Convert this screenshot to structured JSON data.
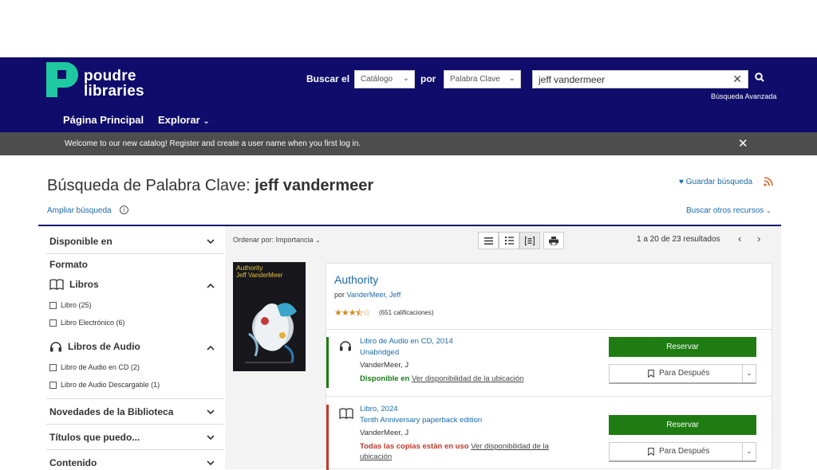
{
  "header": {
    "brand_line1": "poudre",
    "brand_line2": "libraries",
    "search_in_label": "Buscar el",
    "search_scope": "Catálogo",
    "by_label": "por",
    "search_type": "Palabra Clave",
    "search_value": "jeff vandermeer",
    "advanced_label": "Búsqueda Avanzada",
    "nav": [
      "Página Principal",
      "Explorar"
    ]
  },
  "banner": {
    "message": "Welcome to our new catalog! Register and create a user name when you first log in."
  },
  "page": {
    "heading_prefix": "Búsqueda de Palabra Clave:",
    "heading_query": "jeff vandermeer",
    "save_search": "Guardar búsqueda",
    "expand_search": "Ampliar búsqueda",
    "other_resources": "Buscar otros recursos"
  },
  "sidebar": {
    "available_in": "Disponible en",
    "format_label": "Formato",
    "books_label": "Libros",
    "books_items": [
      {
        "label": "Libro (25)"
      },
      {
        "label": "Libro Electrónico (6)"
      }
    ],
    "audio_label": "Libros de Audio",
    "audio_items": [
      {
        "label": "Libro de Audio en CD (2)"
      },
      {
        "label": "Libro de Audio Descargable (1)"
      }
    ],
    "new_items": "Novedades de la Biblioteca",
    "titles_label": "Títulos que puedo...",
    "content_label": "Contenido"
  },
  "results": {
    "sort_label": "Ordenar por: Importancia",
    "count": "1 a 20 de 23 resultados",
    "item": {
      "title": "Authority",
      "by": "por",
      "author": "VanderMeer, Jeff",
      "rating_value": 3.5,
      "rating_max": 5,
      "ratings_count": "(651 calificaciones)",
      "cover_title": "Authority",
      "cover_author": "Jeff VanderMeer",
      "formats": [
        {
          "name": "Libro de Audio en CD, 2014",
          "edition": "Unabridged",
          "author": "VanderMeer, J",
          "status": "Disponible en",
          "location_link": "Ver disponibilidad de la ubicación",
          "reserve": "Reservar",
          "later": "Para Después"
        },
        {
          "name": "Libro, 2024",
          "edition": "Tenth Anniversary paperback edition",
          "author": "VanderMeer, J",
          "status": "Todas las copias están en uso",
          "location_link": "Ver disponibilidad de la ubicación",
          "reserve": "Reservar",
          "later": "Para Después"
        }
      ]
    }
  },
  "colors": {
    "navy": "#0f0c6b",
    "teal": "#1ec8a0",
    "green": "#1f7c12",
    "link": "#1a6aa8",
    "red": "#c0392b"
  }
}
